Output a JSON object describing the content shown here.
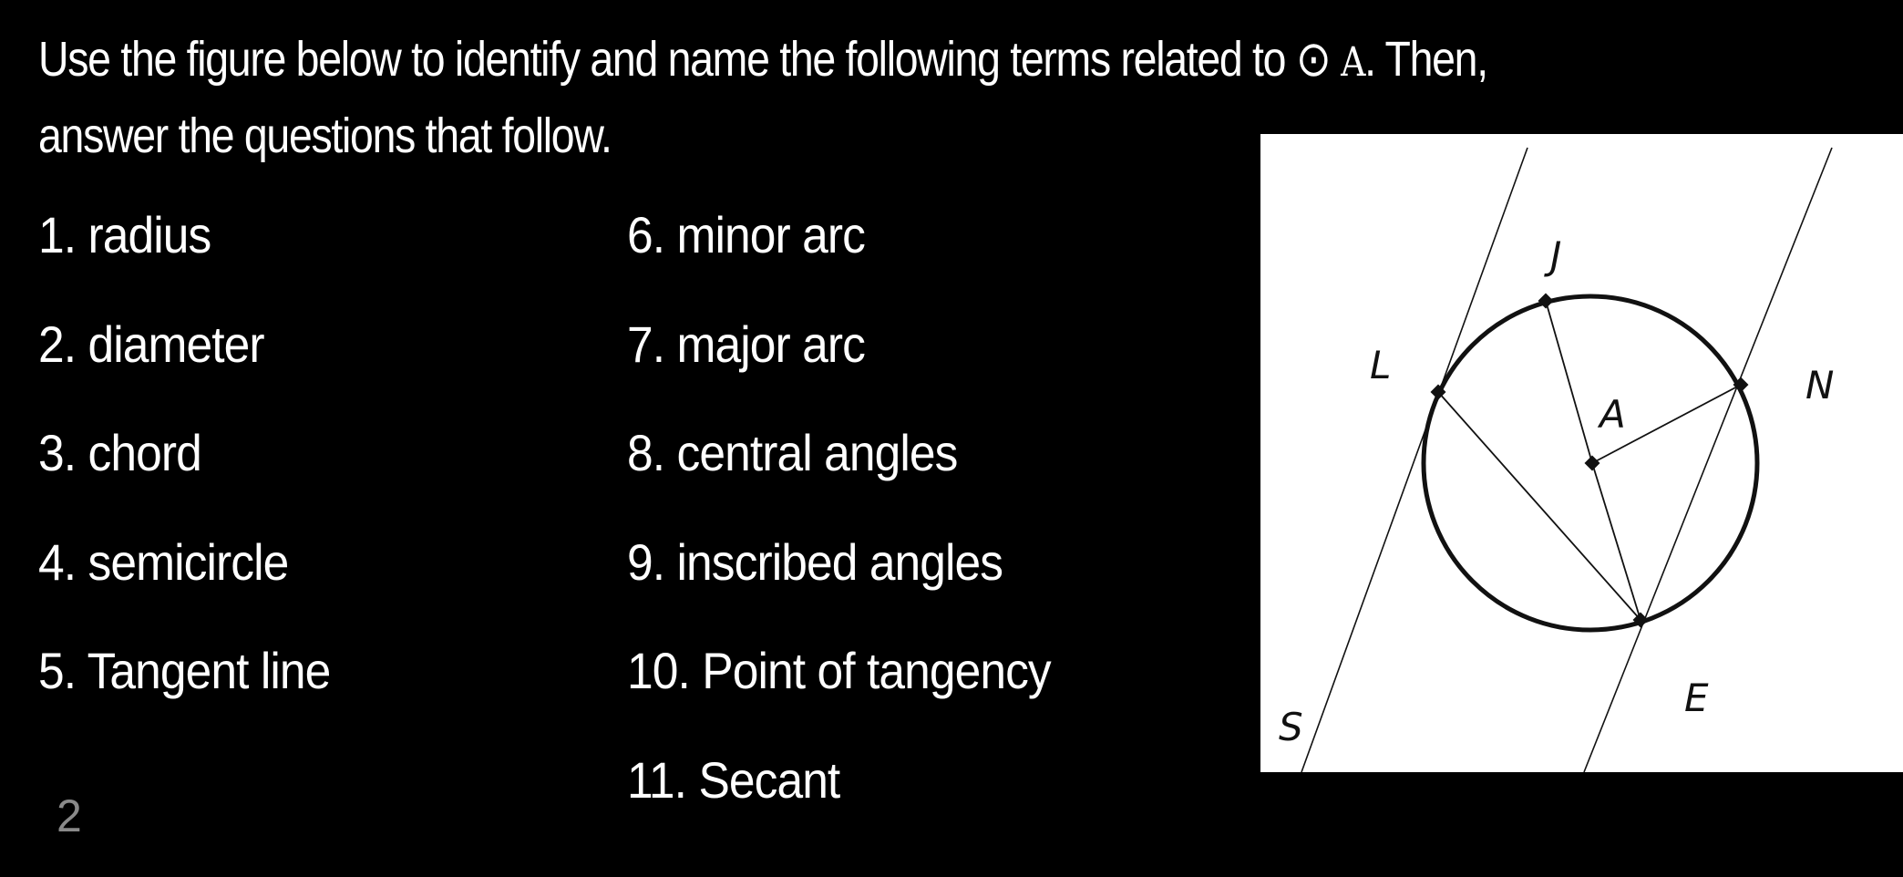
{
  "instructions": {
    "line1_text": "Use the figure below to identify and name the following terms related to",
    "circle_symbol": "⊙",
    "circle_name": "A",
    "line1_end": ". Then,",
    "line2": "answer the questions that follow."
  },
  "terms": {
    "column1": [
      {
        "number": "1.",
        "label": "radius"
      },
      {
        "number": "2.",
        "label": "diameter"
      },
      {
        "number": "3.",
        "label": "chord"
      },
      {
        "number": "4.",
        "label": "semicircle"
      },
      {
        "number": "5.",
        "label": "Tangent line"
      }
    ],
    "column2": [
      {
        "number": "6.",
        "label": "minor arc"
      },
      {
        "number": "7.",
        "label": "major arc"
      },
      {
        "number": "8.",
        "label": "central angles"
      },
      {
        "number": "9.",
        "label": "inscribed angles"
      },
      {
        "number": "10.",
        "label": "Point of tangency"
      },
      {
        "number": "11.",
        "label": "Secant"
      }
    ]
  },
  "page_number": "2",
  "figure": {
    "labels": {
      "J": "J",
      "L": "L",
      "A": "A",
      "N": "N",
      "E": "E",
      "S": "S"
    }
  }
}
